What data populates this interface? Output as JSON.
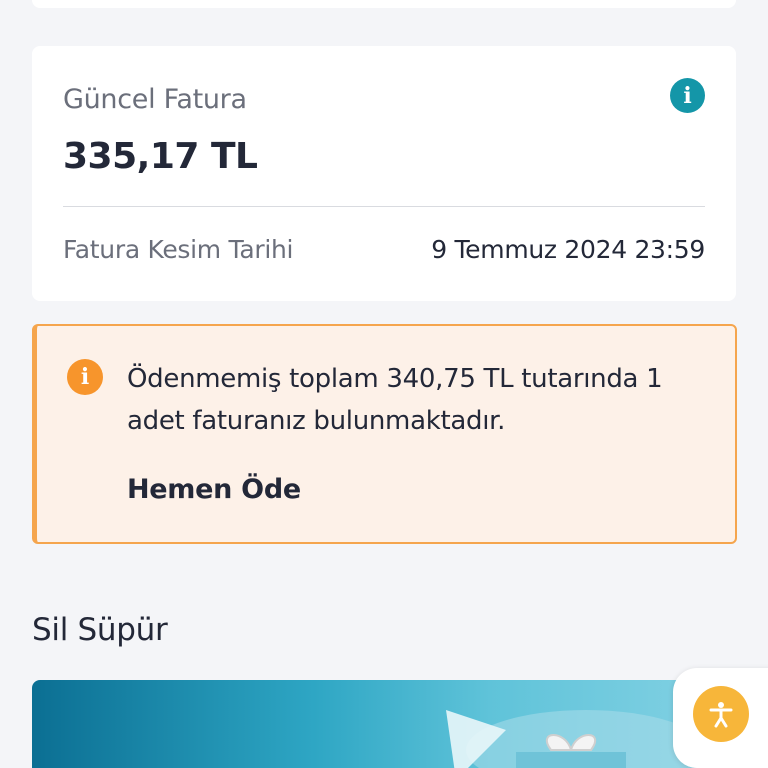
{
  "bill": {
    "label": "Güncel Fatura",
    "amount": "335,17 TL",
    "cut_date_label": "Fatura Kesim Tarihi",
    "cut_date_value": "9 Temmuz 2024 23:59",
    "info_icon": "info-icon"
  },
  "alert": {
    "message": "Ödenmemiş toplam 340,75 TL tutarında 1 adet faturanız bulunmaktadır.",
    "action_label": "Hemen Öde",
    "icon": "info-icon",
    "accent_color": "#f7952c"
  },
  "section": {
    "title": "Sil Süpür"
  },
  "accessibility_button": {
    "icon": "accessibility-icon",
    "color": "#f7b63a"
  },
  "colors": {
    "info_teal": "#1496a8",
    "alert_background": "#fdf1e8",
    "alert_border": "#f5a54d"
  }
}
